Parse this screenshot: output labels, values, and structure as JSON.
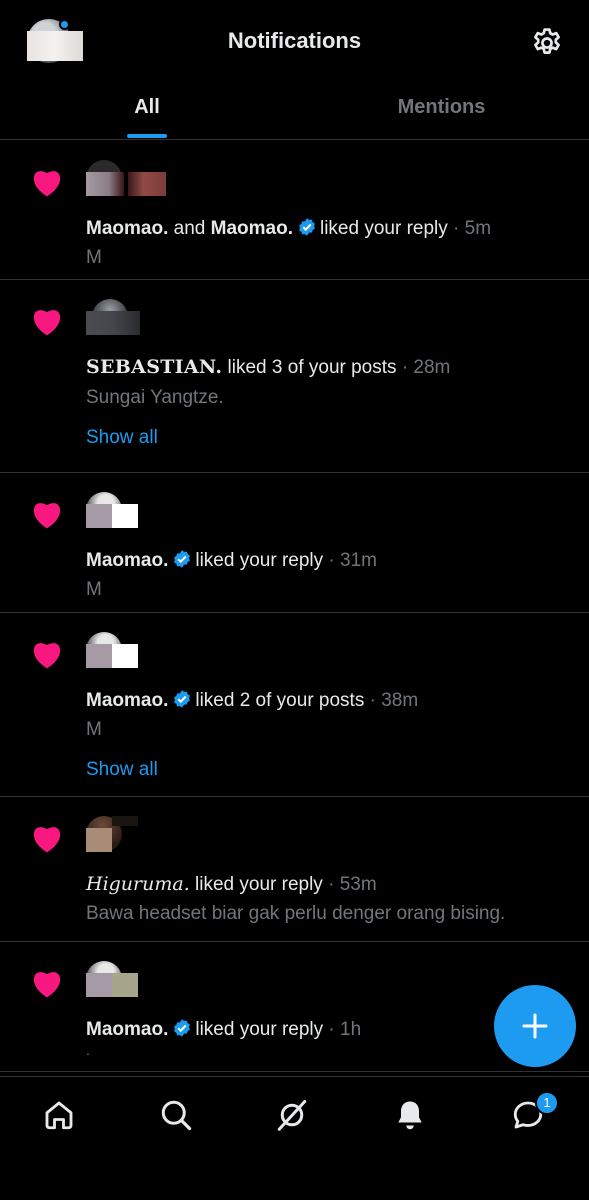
{
  "header": {
    "title": "Notifications",
    "settings_icon": "gear-icon"
  },
  "tabs": [
    {
      "label": "All",
      "active": true
    },
    {
      "label": "Mentions",
      "active": false
    }
  ],
  "notifications": [
    {
      "user1": "Maomao.",
      "connector": "and",
      "user2": "Maomao.",
      "action": "liked your reply",
      "time": "5m",
      "snippet": "M"
    },
    {
      "user1": "SEBASTIAN.",
      "action": "liked 3 of your posts",
      "time": "28m",
      "snippet": "Sungai Yangtze.",
      "show_all": "Show all"
    },
    {
      "user1": "Maomao.",
      "action": "liked your reply",
      "time": "31m",
      "snippet": "M"
    },
    {
      "user1": "Maomao.",
      "action": "liked 2 of your posts",
      "time": "38m",
      "snippet": "M",
      "show_all": "Show all"
    },
    {
      "user1": "Higuruma.",
      "action": "liked your reply",
      "time": "53m",
      "snippet": "Bawa headset biar gak perlu denger orang bising."
    },
    {
      "user1": "Maomao.",
      "action": "liked your reply",
      "time": "1h",
      "snippet": "."
    }
  ],
  "separator": "·",
  "bottom_nav": {
    "items": [
      "home-icon",
      "search-icon",
      "grok-icon",
      "notifications-bell-icon",
      "messages-icon"
    ],
    "messages_count": "1"
  },
  "fab_icon": "plus-icon",
  "colors": {
    "accent": "#1d9bf0",
    "heart": "#f91880",
    "background": "#000000",
    "secondary_text": "#71767b",
    "primary_text": "#e7e9ea",
    "divider": "#2f3336"
  }
}
